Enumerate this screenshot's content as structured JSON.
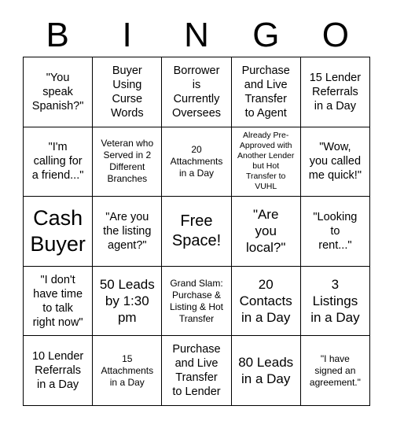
{
  "card": {
    "title": "BINGO",
    "header_letters": [
      "B",
      "I",
      "N",
      "G",
      "O"
    ],
    "grid_size": "5x5",
    "colors": {
      "background": "#ffffff",
      "text": "#000000",
      "grid_line": "#000000"
    },
    "cells": [
      {
        "text": "\"You\nspeak\nSpanish?\"",
        "size": "md",
        "free_space": false
      },
      {
        "text": "Buyer\nUsing\nCurse\nWords",
        "size": "md",
        "free_space": false
      },
      {
        "text": "Borrower\nis\nCurrently\nOversees",
        "size": "md",
        "free_space": false
      },
      {
        "text": "Purchase\nand Live\nTransfer\nto Agent",
        "size": "md",
        "free_space": false
      },
      {
        "text": "15 Lender\nReferrals\nin a Day",
        "size": "md",
        "free_space": false
      },
      {
        "text": "\"I'm\ncalling for\na friend...\"",
        "size": "md",
        "free_space": false
      },
      {
        "text": "Veteran who\nServed in 2\nDifferent\nBranches",
        "size": "sm",
        "free_space": false
      },
      {
        "text": "20\nAttachments\nin a Day",
        "size": "sm",
        "free_space": false
      },
      {
        "text": "Already Pre-\nApproved with\nAnother Lender\nbut Hot\nTransfer to\nVUHL",
        "size": "xs",
        "free_space": false
      },
      {
        "text": "\"Wow,\nyou called\nme quick!\"",
        "size": "md",
        "free_space": false
      },
      {
        "text": "Cash\nBuyer",
        "size": "xxl",
        "free_space": false
      },
      {
        "text": "\"Are you\nthe listing\nagent?\"",
        "size": "md",
        "free_space": false
      },
      {
        "text": "Free\nSpace!",
        "size": "xl",
        "free_space": true
      },
      {
        "text": "\"Are\nyou\nlocal?\"",
        "size": "lg",
        "free_space": false
      },
      {
        "text": "\"Looking\nto\nrent...\"",
        "size": "md",
        "free_space": false
      },
      {
        "text": "\"I don't\nhave time\nto talk\nright now\"",
        "size": "md",
        "free_space": false
      },
      {
        "text": "50 Leads\nby 1:30\npm",
        "size": "lg",
        "free_space": false
      },
      {
        "text": "Grand Slam:\nPurchase &\nListing & Hot\nTransfer",
        "size": "sm",
        "free_space": false
      },
      {
        "text": "20\nContacts\nin a Day",
        "size": "lg",
        "free_space": false
      },
      {
        "text": "3\nListings\nin a Day",
        "size": "lg",
        "free_space": false
      },
      {
        "text": "10 Lender\nReferrals\nin a Day",
        "size": "md",
        "free_space": false
      },
      {
        "text": "15\nAttachments\nin a Day",
        "size": "sm",
        "free_space": false
      },
      {
        "text": "Purchase\nand Live\nTransfer\nto Lender",
        "size": "md",
        "free_space": false
      },
      {
        "text": "80 Leads\nin a Day",
        "size": "lg",
        "free_space": false
      },
      {
        "text": "\"I have\nsigned an\nagreement.\"",
        "size": "sm",
        "free_space": false
      }
    ]
  }
}
